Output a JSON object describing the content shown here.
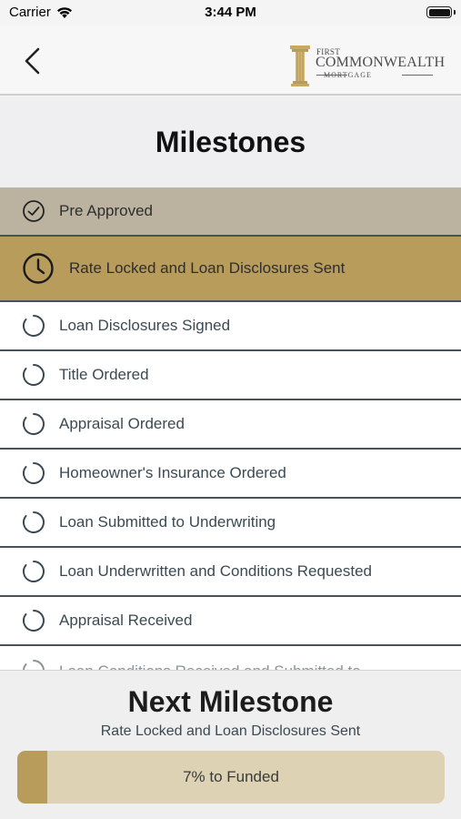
{
  "status_bar": {
    "carrier": "Carrier",
    "time": "3:44 PM"
  },
  "logo": {
    "line1": "FIRST",
    "line2": "COMMONWEALTH",
    "line3": "MORTGAGE"
  },
  "page": {
    "title": "Milestones"
  },
  "milestones": [
    {
      "label": "Pre Approved",
      "state": "done",
      "icon": "check-circle-icon"
    },
    {
      "label": "Rate Locked and Loan Disclosures Sent",
      "state": "current",
      "icon": "clock-icon"
    },
    {
      "label": "Loan Disclosures Signed",
      "state": "pending",
      "icon": "progress-ring-icon"
    },
    {
      "label": "Title Ordered",
      "state": "pending",
      "icon": "progress-ring-icon"
    },
    {
      "label": "Appraisal Ordered",
      "state": "pending",
      "icon": "progress-ring-icon"
    },
    {
      "label": "Homeowner's Insurance Ordered",
      "state": "pending",
      "icon": "progress-ring-icon"
    },
    {
      "label": "Loan Submitted to Underwriting",
      "state": "pending",
      "icon": "progress-ring-icon"
    },
    {
      "label": "Loan Underwritten and Conditions Requested",
      "state": "pending",
      "icon": "progress-ring-icon"
    },
    {
      "label": "Appraisal Received",
      "state": "pending",
      "icon": "progress-ring-icon"
    },
    {
      "label": "Loan Conditions Received and Submitted to",
      "state": "pending",
      "icon": "progress-ring-icon"
    }
  ],
  "next": {
    "title": "Next Milestone",
    "subtitle": "Rate Locked and Loan Disclosures Sent",
    "progress_label": "7% to Funded",
    "progress_fraction": 0.07
  },
  "colors": {
    "done": "#bbb3a0",
    "current": "#b89c5c",
    "progress_track": "#ddd3b4",
    "progress_fill": "#b89c5c"
  }
}
